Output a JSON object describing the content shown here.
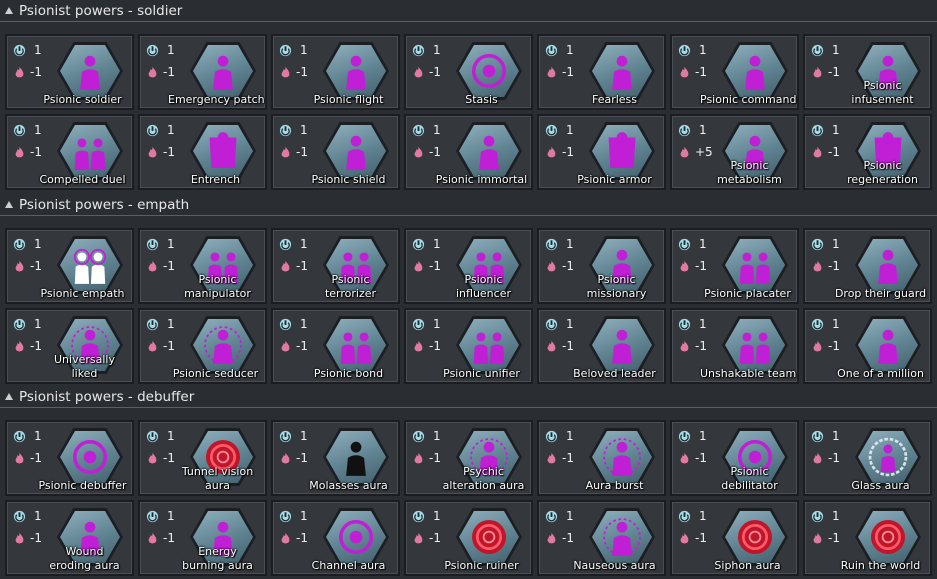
{
  "colors": {
    "cost_icon": "#a6dbe8",
    "upkeep_icon": "#e07aa0",
    "psionic": "#c01fd6",
    "hex_bg": "#7a9ba8"
  },
  "icons": {
    "cost": "power-icon",
    "upkeep": "flame-icon"
  },
  "sections": [
    {
      "title": "Psionist powers - soldier",
      "cards": [
        {
          "label": "Psionic soldier",
          "cost": "1",
          "upkeep": "-1",
          "icon": "rifle-icon"
        },
        {
          "label": "Emergency patch",
          "cost": "1",
          "upkeep": "-1",
          "icon": "bandage-icon"
        },
        {
          "label": "Psionic flight",
          "cost": "1",
          "upkeep": "-1",
          "icon": "wings-icon"
        },
        {
          "label": "Stasis",
          "cost": "1",
          "upkeep": "-1",
          "icon": "stasis-icon"
        },
        {
          "label": "Fearless",
          "cost": "1",
          "upkeep": "-1",
          "icon": "fearless-icon"
        },
        {
          "label": "Psionic commando",
          "cost": "1",
          "upkeep": "-1",
          "icon": "commando-icon"
        },
        {
          "label": "Psionic infusement",
          "cost": "1",
          "upkeep": "-1",
          "icon": "infusement-icon"
        },
        {
          "label": "Compelled duel",
          "cost": "1",
          "upkeep": "-1",
          "icon": "duel-icon"
        },
        {
          "label": "Entrench",
          "cost": "1",
          "upkeep": "-1",
          "icon": "entrench-icon"
        },
        {
          "label": "Psionic shield",
          "cost": "1",
          "upkeep": "-1",
          "icon": "shield-icon"
        },
        {
          "label": "Psionic immortal",
          "cost": "1",
          "upkeep": "-1",
          "icon": "immortal-icon"
        },
        {
          "label": "Psionic armor",
          "cost": "1",
          "upkeep": "-1",
          "icon": "armor-icon"
        },
        {
          "label": "Psionic metabolism",
          "cost": "1",
          "upkeep": "+5",
          "icon": "metabolism-icon"
        },
        {
          "label": "Psionic regeneration",
          "cost": "1",
          "upkeep": "-1",
          "icon": "regeneration-icon"
        }
      ]
    },
    {
      "title": "Psionist powers - empath",
      "cards": [
        {
          "label": "Psionic empath",
          "cost": "1",
          "upkeep": "-1",
          "icon": "empath-icon"
        },
        {
          "label": "Psionic manipulator",
          "cost": "1",
          "upkeep": "-1",
          "icon": "manipulator-icon"
        },
        {
          "label": "Psionic terrorizer",
          "cost": "1",
          "upkeep": "-1",
          "icon": "terrorizer-icon"
        },
        {
          "label": "Psionic influencer",
          "cost": "1",
          "upkeep": "-1",
          "icon": "influencer-icon"
        },
        {
          "label": "Psionic missionary",
          "cost": "1",
          "upkeep": "-1",
          "icon": "missionary-icon"
        },
        {
          "label": "Psionic placater",
          "cost": "1",
          "upkeep": "-1",
          "icon": "placater-icon"
        },
        {
          "label": "Drop their guard",
          "cost": "1",
          "upkeep": "-1",
          "icon": "drop-guard-icon"
        },
        {
          "label": "Universally liked",
          "cost": "1",
          "upkeep": "-1",
          "icon": "liked-icon"
        },
        {
          "label": "Psionic seducer",
          "cost": "1",
          "upkeep": "-1",
          "icon": "seducer-icon"
        },
        {
          "label": "Psionic bond",
          "cost": "1",
          "upkeep": "-1",
          "icon": "bond-icon"
        },
        {
          "label": "Psionic unifier",
          "cost": "1",
          "upkeep": "-1",
          "icon": "unifier-icon"
        },
        {
          "label": "Beloved leader",
          "cost": "1",
          "upkeep": "-1",
          "icon": "leader-icon"
        },
        {
          "label": "Unshakable team",
          "cost": "1",
          "upkeep": "-1",
          "icon": "team-icon"
        },
        {
          "label": "One of a million",
          "cost": "1",
          "upkeep": "-1",
          "icon": "million-icon"
        }
      ]
    },
    {
      "title": "Psionist powers - debuffer",
      "cards": [
        {
          "label": "Psionic debuffer",
          "cost": "1",
          "upkeep": "-1",
          "icon": "debuffer-icon"
        },
        {
          "label": "Tunnel vision aura",
          "cost": "1",
          "upkeep": "-1",
          "icon": "tunnel-vision-icon"
        },
        {
          "label": "Molasses aura",
          "cost": "1",
          "upkeep": "-1",
          "icon": "molasses-icon"
        },
        {
          "label": "Psychic alteration aura",
          "cost": "1",
          "upkeep": "-1",
          "icon": "alteration-icon"
        },
        {
          "label": "Aura burst",
          "cost": "1",
          "upkeep": "-1",
          "icon": "burst-icon"
        },
        {
          "label": "Psionic debilitator",
          "cost": "1",
          "upkeep": "-1",
          "icon": "debilitator-icon"
        },
        {
          "label": "Glass aura",
          "cost": "1",
          "upkeep": "-1",
          "icon": "glass-icon"
        },
        {
          "label": "Wound eroding aura",
          "cost": "1",
          "upkeep": "-1",
          "icon": "wound-icon"
        },
        {
          "label": "Energy burning aura",
          "cost": "1",
          "upkeep": "-1",
          "icon": "energy-burn-icon"
        },
        {
          "label": "Channel aura",
          "cost": "1",
          "upkeep": "-1",
          "icon": "channel-icon"
        },
        {
          "label": "Psionic ruiner",
          "cost": "1",
          "upkeep": "-1",
          "icon": "ruiner-icon"
        },
        {
          "label": "Nauseous aura",
          "cost": "1",
          "upkeep": "-1",
          "icon": "nauseous-icon"
        },
        {
          "label": "Siphon aura",
          "cost": "1",
          "upkeep": "-1",
          "icon": "siphon-icon"
        },
        {
          "label": "Ruin the world",
          "cost": "1",
          "upkeep": "-1",
          "icon": "ruin-world-icon"
        }
      ]
    }
  ]
}
